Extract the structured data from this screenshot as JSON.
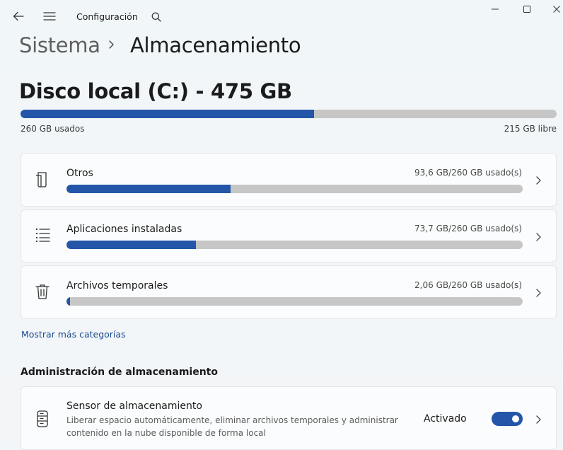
{
  "window": {
    "app_title": "Configuración",
    "controls": [
      "minimize",
      "maximize",
      "close"
    ]
  },
  "breadcrumb": {
    "parent": "Sistema",
    "current": "Almacenamiento"
  },
  "disk": {
    "title": "Disco local (C:) - 475 GB",
    "used_label": "260 GB usados",
    "free_label": "215 GB libre",
    "used_fraction": 0.547
  },
  "categories": [
    {
      "label": "Otros",
      "usage": "93,6 GB/260 GB usado(s)",
      "fraction": 0.36,
      "icon": "document-icon"
    },
    {
      "label": "Aplicaciones instaladas",
      "usage": "73,7 GB/260 GB usado(s)",
      "fraction": 0.283,
      "icon": "list-icon"
    },
    {
      "label": "Archivos temporales",
      "usage": "2,06 GB/260 GB usado(s)",
      "fraction": 0.008,
      "icon": "trash-icon"
    }
  ],
  "more_categories_link": "Mostrar más categorías",
  "management": {
    "heading": "Administración de almacenamiento",
    "sensor": {
      "title": "Sensor de almacenamiento",
      "description": "Liberar espacio automáticamente, eliminar archivos temporales y administrar contenido en la nube disponible de forma local",
      "status": "Activado",
      "enabled": true
    }
  },
  "colors": {
    "accent": "#2356a8",
    "bar_track": "#c6c6c6"
  }
}
